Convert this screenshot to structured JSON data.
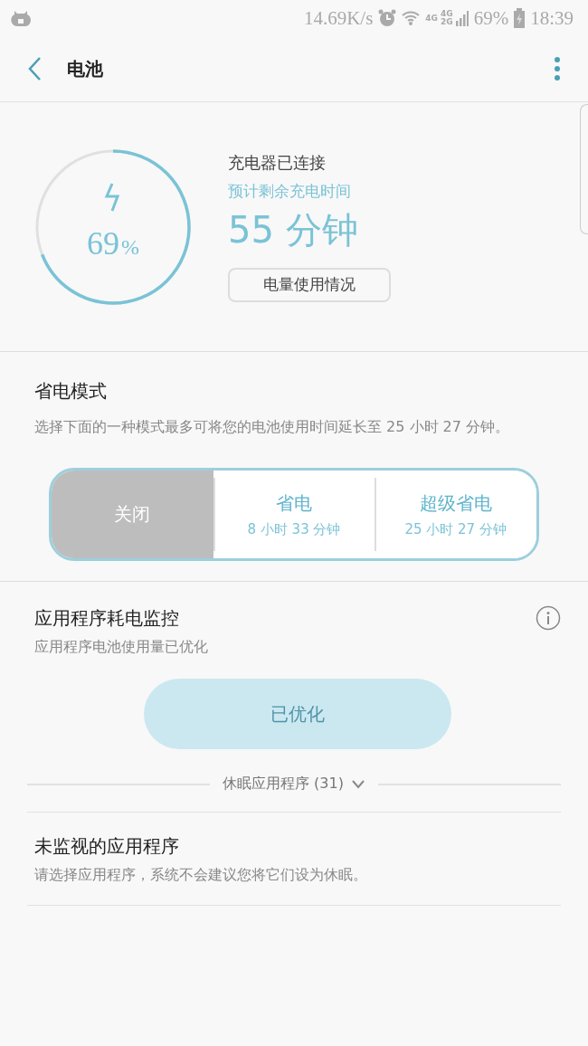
{
  "status_bar": {
    "speed": "14.69K/s",
    "network_labels": [
      "4G",
      "4G",
      "2G"
    ],
    "battery": "69%",
    "time": "18:39"
  },
  "app_bar": {
    "title": "电池"
  },
  "battery": {
    "percent": "69",
    "percent_sign": "%",
    "status": "充电器已连接",
    "remaining_label": "预计剩余充电时间",
    "remaining": "55 分钟",
    "usage_button": "电量使用情况"
  },
  "power_saving": {
    "title": "省电模式",
    "description": "选择下面的一种模式最多可将您的电池使用时间延长至 25 小时 27 分钟。",
    "modes": [
      {
        "label": "关闭",
        "selected": true
      },
      {
        "label": "省电",
        "time": "8 小时 33 分钟",
        "selected": false
      },
      {
        "label": "超级省电",
        "time": "25 小时 27 分钟",
        "selected": false
      }
    ]
  },
  "app_monitor": {
    "title": "应用程序耗电监控",
    "subtitle": "应用程序电池使用量已优化",
    "button": {
      "label": "已优化",
      "disabled": true
    },
    "sleeping_apps": {
      "label": "休眠应用程序 (31)",
      "expanded": false
    }
  },
  "unmonitored": {
    "title": "未监视的应用程序",
    "description": "请选择应用程序，系统不会建议您将它们设为休眠。"
  }
}
